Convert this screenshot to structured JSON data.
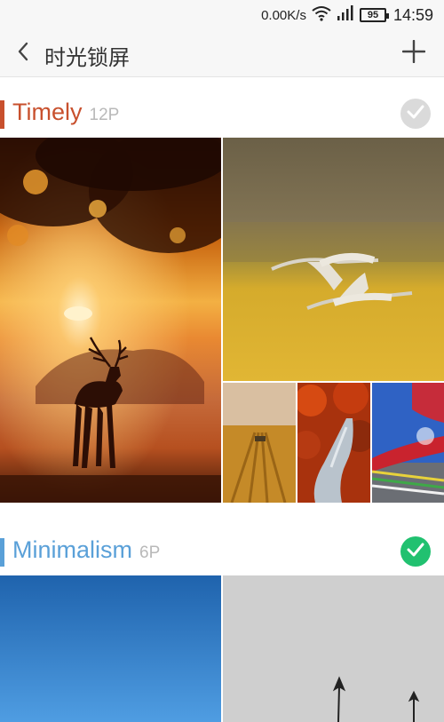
{
  "status_bar": {
    "net_speed": "0.00K/s",
    "battery": "95",
    "time": "14:59"
  },
  "header": {
    "title": "时光锁屏"
  },
  "sections": [
    {
      "title": "Timely",
      "count": "12P",
      "accent": "#c8502d",
      "title_color": "#c8502d",
      "selected": false,
      "check_color": "#dadada"
    },
    {
      "title": "Minimalism",
      "count": "6P",
      "accent": "#5aa0d8",
      "title_color": "#5aa0d8",
      "selected": true,
      "check_color": "#21c170"
    }
  ],
  "icons": {
    "back": "chevron-left-icon",
    "add": "plus-icon",
    "wifi": "wifi-icon",
    "signal": "signal-icon",
    "battery": "battery-icon",
    "check": "check-icon"
  },
  "images": {
    "deer": "deer-sunset-photo",
    "cranes": "flying-cranes-photo",
    "field": "wheat-field-photo",
    "stream": "red-forest-stream-photo",
    "prayer": "prayer-flags-photo",
    "blue_sky": "blue-sky-photo",
    "grey_posts": "grey-posts-photo"
  }
}
